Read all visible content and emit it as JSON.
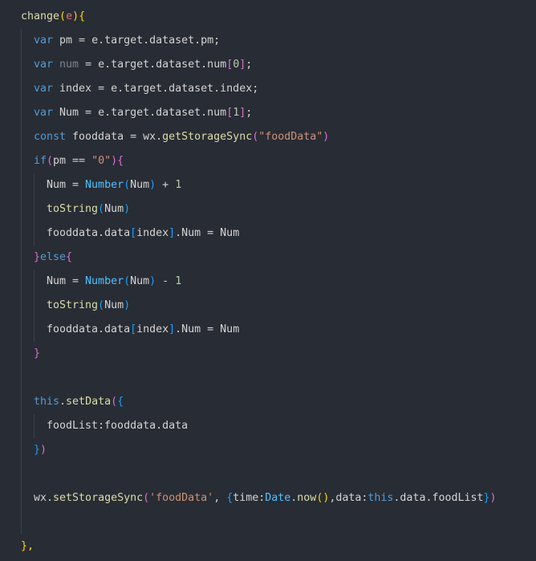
{
  "editor": {
    "background": "#282c34",
    "colors": {
      "plain": "#d4d4d4",
      "keyword": "#569cd6",
      "function": "#dcdcaa",
      "builtin": "#4fc1ff",
      "string": "#ce9178",
      "number": "#b5cea8",
      "bracket_level_1": "#ffd700",
      "bracket_level_2": "#da70d6",
      "bracket_level_3": "#179fff",
      "muted": "#7f848e",
      "error": "#e06c75"
    },
    "lines": [
      {
        "tokens": [
          {
            "t": "change",
            "c": "fn"
          },
          {
            "t": "(",
            "c": "br1"
          },
          {
            "t": "e",
            "c": "red"
          },
          {
            "t": ")",
            "c": "br1"
          },
          {
            "t": "{",
            "c": "br1"
          }
        ]
      },
      {
        "tokens": [
          {
            "t": "var",
            "c": "kw"
          },
          {
            "t": " pm = e.target.dataset.pm;",
            "c": "plain"
          }
        ]
      },
      {
        "tokens": [
          {
            "t": "var",
            "c": "kw"
          },
          {
            "t": " ",
            "c": "plain"
          },
          {
            "t": "num",
            "c": "dim"
          },
          {
            "t": " = e.target.dataset.num",
            "c": "plain"
          },
          {
            "t": "[",
            "c": "br2"
          },
          {
            "t": "0",
            "c": "num"
          },
          {
            "t": "]",
            "c": "br2"
          },
          {
            "t": ";",
            "c": "plain"
          }
        ]
      },
      {
        "tokens": [
          {
            "t": "var",
            "c": "kw"
          },
          {
            "t": " index = e.target.dataset.index;",
            "c": "plain"
          }
        ]
      },
      {
        "tokens": [
          {
            "t": "var",
            "c": "kw"
          },
          {
            "t": " Num = e.target.dataset.num",
            "c": "plain"
          },
          {
            "t": "[",
            "c": "br2"
          },
          {
            "t": "1",
            "c": "num"
          },
          {
            "t": "]",
            "c": "br2"
          },
          {
            "t": ";",
            "c": "plain"
          }
        ]
      },
      {
        "tokens": [
          {
            "t": "const",
            "c": "kw"
          },
          {
            "t": " fooddata = wx.",
            "c": "plain"
          },
          {
            "t": "getStorageSync",
            "c": "fn"
          },
          {
            "t": "(",
            "c": "br2"
          },
          {
            "t": "\"foodData\"",
            "c": "str"
          },
          {
            "t": ")",
            "c": "br2"
          }
        ]
      },
      {
        "tokens": [
          {
            "t": "if",
            "c": "kw"
          },
          {
            "t": "(",
            "c": "br2"
          },
          {
            "t": "pm == ",
            "c": "plain"
          },
          {
            "t": "\"0\"",
            "c": "str"
          },
          {
            "t": ")",
            "c": "br2"
          },
          {
            "t": "{",
            "c": "br2"
          }
        ]
      },
      {
        "tokens": [
          {
            "t": "Num = ",
            "c": "plain"
          },
          {
            "t": "Number",
            "c": "fnb"
          },
          {
            "t": "(",
            "c": "br3"
          },
          {
            "t": "Num",
            "c": "plain"
          },
          {
            "t": ")",
            "c": "br3"
          },
          {
            "t": " + ",
            "c": "plain"
          },
          {
            "t": "1",
            "c": "num"
          }
        ]
      },
      {
        "tokens": [
          {
            "t": "toString",
            "c": "fn"
          },
          {
            "t": "(",
            "c": "br3"
          },
          {
            "t": "Num",
            "c": "plain"
          },
          {
            "t": ")",
            "c": "br3"
          }
        ]
      },
      {
        "tokens": [
          {
            "t": "fooddata.data",
            "c": "plain"
          },
          {
            "t": "[",
            "c": "br3"
          },
          {
            "t": "index",
            "c": "plain"
          },
          {
            "t": "]",
            "c": "br3"
          },
          {
            "t": ".Num = Num",
            "c": "plain"
          }
        ]
      },
      {
        "tokens": [
          {
            "t": "}",
            "c": "br2"
          },
          {
            "t": "else",
            "c": "kw"
          },
          {
            "t": "{",
            "c": "br2"
          }
        ]
      },
      {
        "tokens": [
          {
            "t": "Num = ",
            "c": "plain"
          },
          {
            "t": "Number",
            "c": "fnb"
          },
          {
            "t": "(",
            "c": "br3"
          },
          {
            "t": "Num",
            "c": "plain"
          },
          {
            "t": ")",
            "c": "br3"
          },
          {
            "t": " - ",
            "c": "plain"
          },
          {
            "t": "1",
            "c": "num"
          }
        ]
      },
      {
        "tokens": [
          {
            "t": "toString",
            "c": "fn"
          },
          {
            "t": "(",
            "c": "br3"
          },
          {
            "t": "Num",
            "c": "plain"
          },
          {
            "t": ")",
            "c": "br3"
          }
        ]
      },
      {
        "tokens": [
          {
            "t": "fooddata.data",
            "c": "plain"
          },
          {
            "t": "[",
            "c": "br3"
          },
          {
            "t": "index",
            "c": "plain"
          },
          {
            "t": "]",
            "c": "br3"
          },
          {
            "t": ".Num = Num",
            "c": "plain"
          }
        ]
      },
      {
        "tokens": [
          {
            "t": "}",
            "c": "br2"
          }
        ]
      },
      {
        "tokens": []
      },
      {
        "tokens": [
          {
            "t": "this",
            "c": "kw"
          },
          {
            "t": ".",
            "c": "plain"
          },
          {
            "t": "setData",
            "c": "fn"
          },
          {
            "t": "(",
            "c": "br2"
          },
          {
            "t": "{",
            "c": "br3"
          }
        ]
      },
      {
        "tokens": [
          {
            "t": "foodList:fooddata.data",
            "c": "plain"
          }
        ]
      },
      {
        "tokens": [
          {
            "t": "}",
            "c": "br3"
          },
          {
            "t": ")",
            "c": "br2"
          }
        ]
      },
      {
        "tokens": []
      },
      {
        "tokens": [
          {
            "t": "wx.",
            "c": "plain"
          },
          {
            "t": "setStorageSync",
            "c": "fn"
          },
          {
            "t": "(",
            "c": "br2"
          },
          {
            "t": "'foodData'",
            "c": "str"
          },
          {
            "t": ", ",
            "c": "plain"
          },
          {
            "t": "{",
            "c": "br3"
          },
          {
            "t": "time:",
            "c": "plain"
          },
          {
            "t": "Date",
            "c": "fnb"
          },
          {
            "t": ".",
            "c": "plain"
          },
          {
            "t": "now",
            "c": "fn"
          },
          {
            "t": "()",
            "c": "br1"
          },
          {
            "t": ",data:",
            "c": "plain"
          },
          {
            "t": "this",
            "c": "kw"
          },
          {
            "t": ".data.foodList",
            "c": "plain"
          },
          {
            "t": "}",
            "c": "br3"
          },
          {
            "t": ")",
            "c": "br2"
          }
        ]
      },
      {
        "tokens": []
      },
      {
        "tokens": [
          {
            "t": "},",
            "c": "br1"
          }
        ]
      }
    ]
  }
}
